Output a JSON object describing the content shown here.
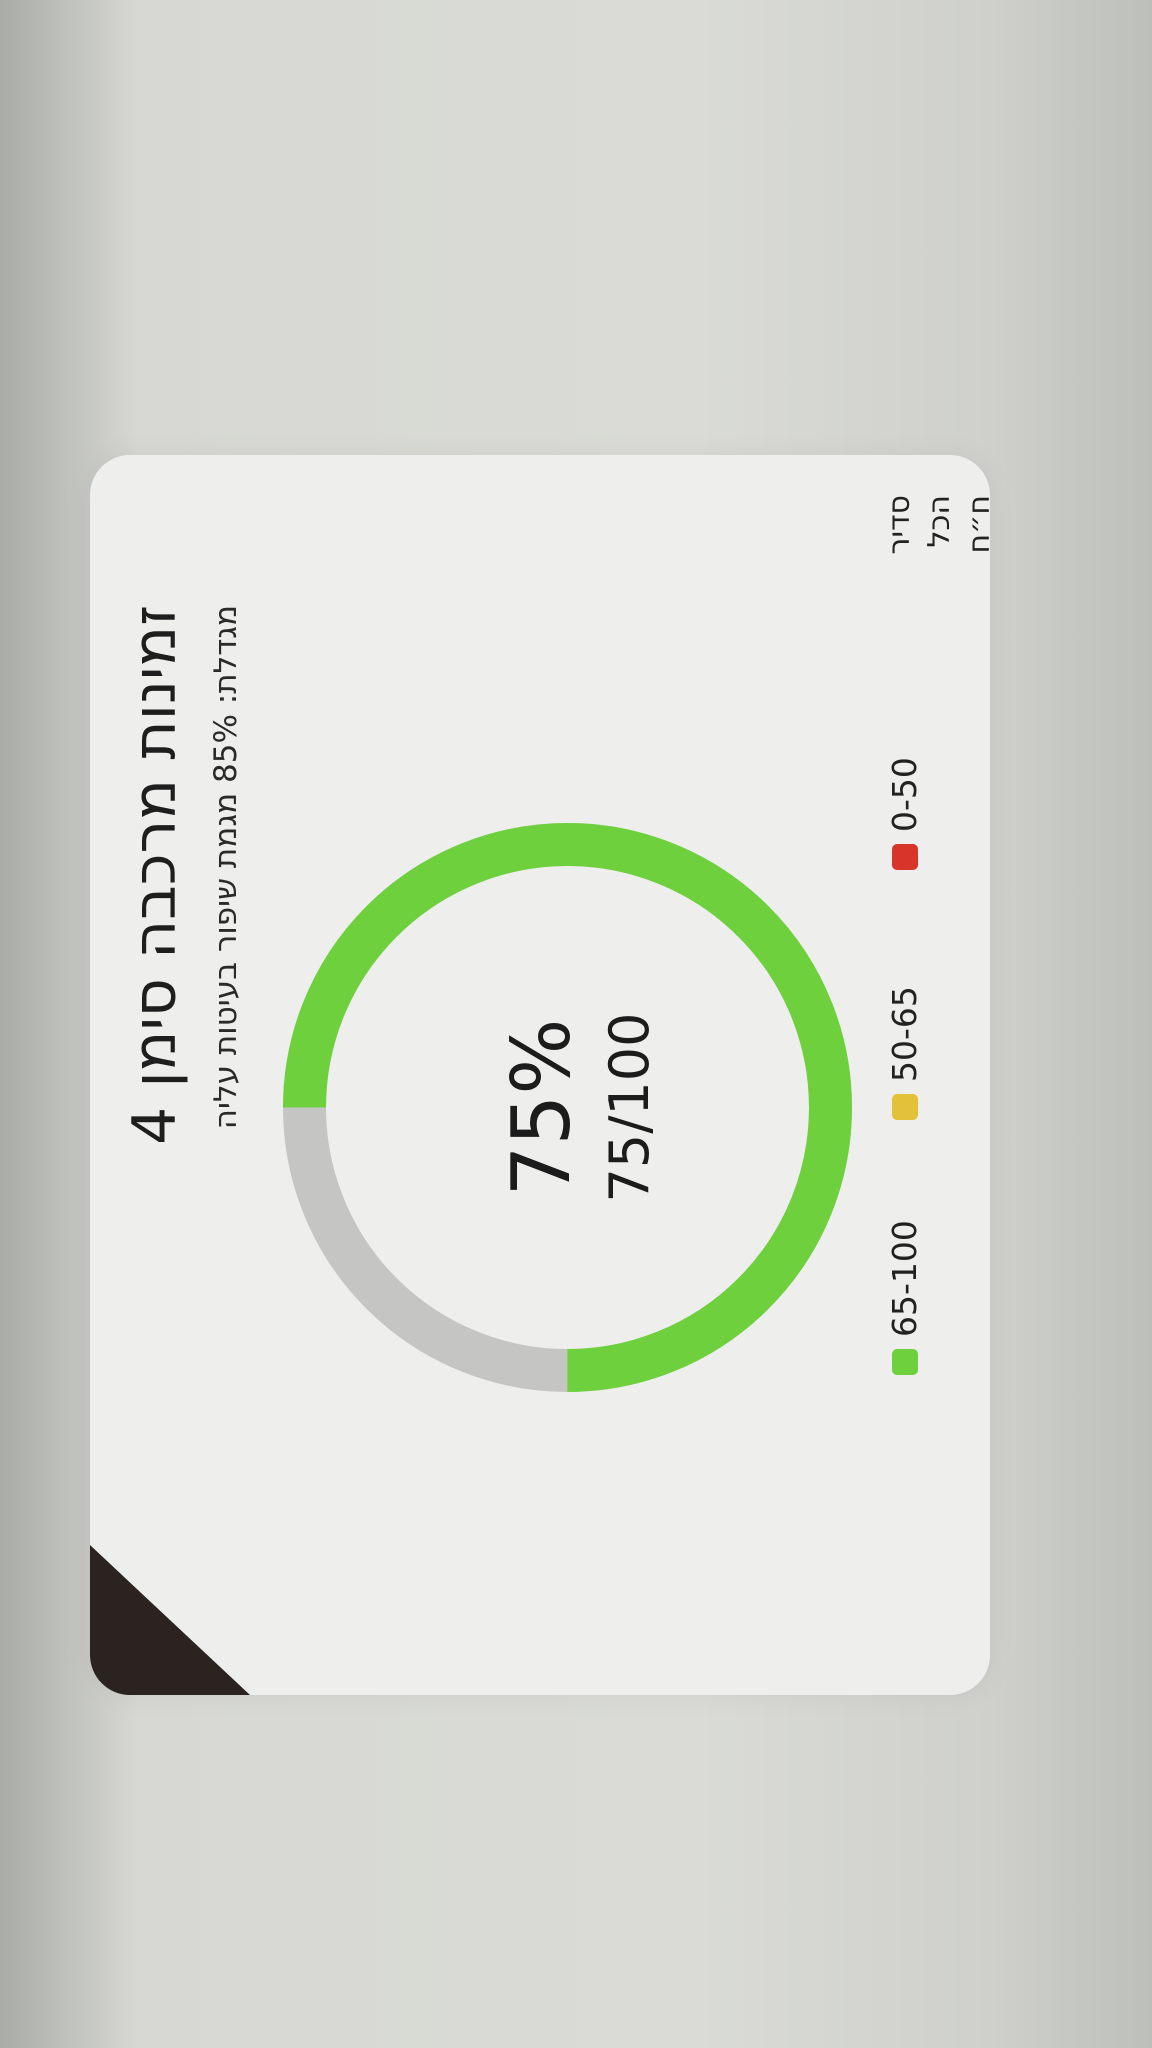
{
  "card": {
    "title": "זמינות מרכבה סימן 4",
    "subtitle": "מגדלת: 85% מגמת שיפור בעיטות עליה",
    "colors": {
      "background": "#eeefed",
      "corner": "#2a2320"
    }
  },
  "gauge": {
    "percent_label": "75%",
    "fraction_label": "75/100",
    "value": 75,
    "max": 100,
    "colors": {
      "filled": "#6ed03c",
      "empty": "#c5c6c3"
    }
  },
  "legend": [
    {
      "label": "65-100",
      "color": "#6ed03c"
    },
    {
      "label": "50-65",
      "color": "#e3c23a"
    },
    {
      "label": "0-50",
      "color": "#d8342a"
    }
  ],
  "side_label": {
    "line1": "סדיר",
    "line2": "הכל",
    "line3": "ח״ח"
  }
}
